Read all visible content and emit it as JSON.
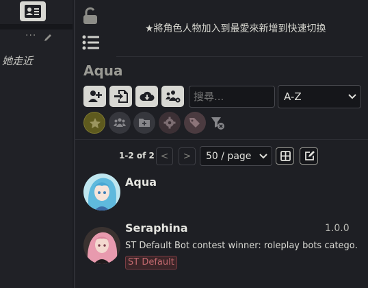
{
  "left_panel": {
    "menu_dots": "···",
    "chat_snippet": "她走近"
  },
  "panel": {
    "hint_star": "★",
    "hint_text": "將角色人物加入到最愛來新增到快速切換",
    "title": "Aqua",
    "search": {
      "placeholder": "搜尋..."
    },
    "sort": {
      "selected": "A-Z"
    },
    "pagination": {
      "count": "1-2 of 2",
      "prev": "<",
      "next": ">",
      "per_page": "50 / page"
    },
    "characters": [
      {
        "name": "Aqua",
        "version": "",
        "description": "",
        "tag": ""
      },
      {
        "name": "Seraphina",
        "version": "1.0.0",
        "description": "ST Default Bot contest winner: roleplay bots catego…",
        "tag": "ST Default"
      }
    ]
  },
  "colors": {
    "background": "#1e1f24",
    "button_light": "#d8d8d3",
    "favorite_chip": "#5e5a1e",
    "tag_red": "#c0686e"
  },
  "icons": [
    "id-card-icon",
    "pencil-icon",
    "lock-open-icon",
    "list-icon",
    "add-user-icon",
    "import-icon",
    "download-cloud-icon",
    "users-gear-icon",
    "star-icon",
    "group-icon",
    "folder-plus-icon",
    "gear-icon",
    "tags-icon",
    "filter-clear-icon",
    "grid-icon",
    "edit-icon",
    "chevron-down-icon"
  ]
}
